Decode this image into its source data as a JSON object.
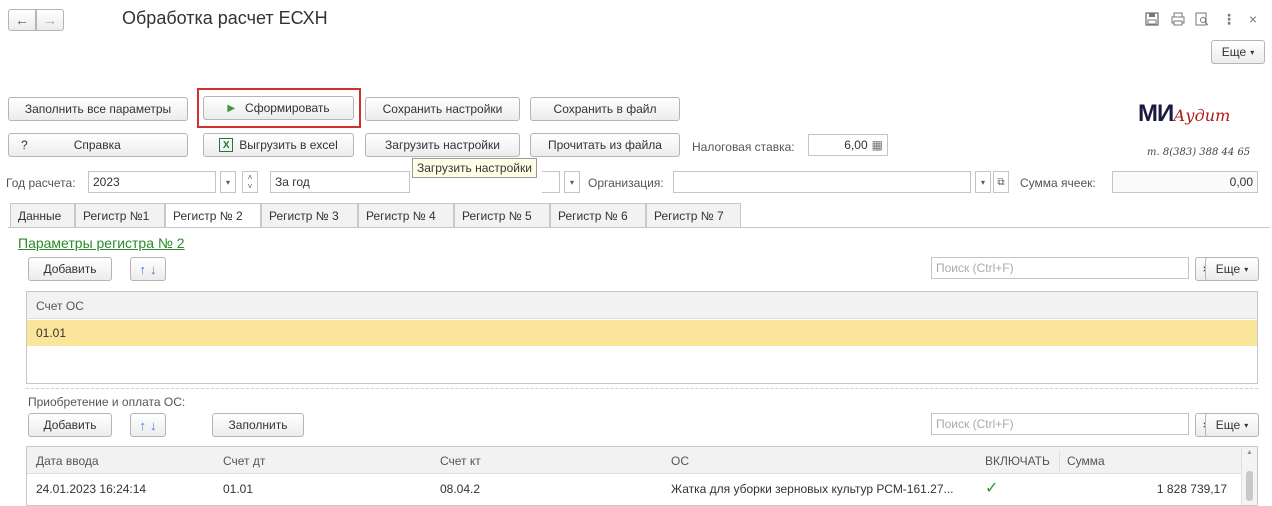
{
  "window": {
    "title": "Обработка расчет ЕСХН",
    "more_label": "Еще"
  },
  "buttons": {
    "fill_all": "Заполнить все параметры",
    "generate": "Сформировать",
    "save_settings": "Сохранить настройки",
    "save_file": "Сохранить в файл",
    "help_q": "?",
    "help": "Справка",
    "export_excel": "Выгрузить в excel",
    "load_settings": "Загрузить настройки",
    "read_file": "Прочитать из файла",
    "tooltip": "Загрузить настройки"
  },
  "tax": {
    "label": "Налоговая ставка:",
    "value": "6,00"
  },
  "logo": {
    "text": "МИ",
    "script": "Аудит",
    "phone": "т. 8(383) 388 44 65"
  },
  "params": {
    "year_label": "Год расчета:",
    "year_value": "2023",
    "period_value": "За год",
    "org_label": "Организация:",
    "org_value": "",
    "sum_label": "Сумма ячеек:",
    "sum_value": "0,00"
  },
  "tabs": [
    "Данные",
    "Регистр №1",
    "Регистр № 2",
    "Регистр № 3",
    "Регистр № 4",
    "Регистр № 5",
    "Регистр № 6",
    "Регистр № 7"
  ],
  "register": {
    "title": "Параметры регистра № 2",
    "add_label": "Добавить",
    "search_placeholder": "Поиск (Ctrl+F)",
    "clear": "×",
    "more_label": "Еще",
    "column": "Счет ОС",
    "rows": [
      "01.01"
    ]
  },
  "acquisition": {
    "label": "Приобретение и оплата ОС:",
    "add_label": "Добавить",
    "fill_label": "Заполнить",
    "search_placeholder": "Поиск (Ctrl+F)",
    "clear": "×",
    "more_label": "Еще",
    "columns": [
      "Дата ввода",
      "Счет дт",
      "Счет кт",
      "ОС",
      "ВКЛЮЧАТЬ",
      "Сумма"
    ],
    "rows": [
      {
        "date": "24.01.2023 16:24:14",
        "debit": "01.01",
        "credit": "08.04.2",
        "asset": "Жатка для уборки зерновых культур РСМ-161.27...",
        "include": "✓",
        "amount": "1 828 739,17"
      }
    ]
  },
  "icons": {
    "back": "←",
    "forward": "→",
    "save": "💾",
    "print": "⎙",
    "preview": "🔍",
    "menu": "⋮",
    "close": "×",
    "up": "↑",
    "down": "↓",
    "play": "▶",
    "calc": "▦",
    "dropdown": "▾",
    "open": "⧉"
  },
  "colors": {
    "highlight_row": "#fbe59a",
    "title_link": "#2a8a2a",
    "red_frame": "#d32f2f",
    "arrow_blue": "#3a7bd5"
  }
}
